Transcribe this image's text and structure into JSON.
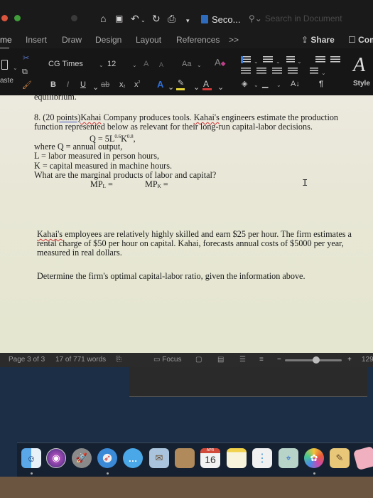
{
  "window": {
    "doc_title": "Seco...",
    "search_placeholder": "Search in Document"
  },
  "quick_access": {
    "home_icon": "⌂",
    "save_icon": "💾",
    "undo_icon": "↶",
    "redo_icon": "↻",
    "print_icon": "⎙",
    "more_icon": "▾"
  },
  "tabs": [
    {
      "label": "me",
      "active": true
    },
    {
      "label": "Insert"
    },
    {
      "label": "Draw"
    },
    {
      "label": "Design"
    },
    {
      "label": "Layout"
    },
    {
      "label": "References"
    },
    {
      "label": ">>"
    }
  ],
  "share_label": "Share",
  "comments_label": "Com",
  "ribbon": {
    "font_name": "CG Times",
    "font_size": "12",
    "grow_font": "A",
    "shrink_font": "A",
    "change_case": "Aa",
    "paste_label": "aste",
    "bold": "B",
    "italic": "I",
    "underline": "U",
    "strikethrough": "ab",
    "subscript": "x",
    "superscript": "x",
    "text_effects": "A",
    "highlight": "✎",
    "font_color": "A",
    "sort": "A↓",
    "pilcrow": "¶",
    "styles_label": "Style",
    "highlight_color": "#e8d63a",
    "font_color_value": "#d23a3a",
    "text_effects_color": "#2f6fd8"
  },
  "document": {
    "cut_off_line": "equilibrium.",
    "q8_num": "8. (20 ",
    "q8_points": "points)",
    "q8_kahai": "Kahai",
    "q8_rest1": " Company produces tools.  ",
    "q8_kahais": "Kahai's",
    "q8_rest2": " engineers estimate the production",
    "line2": "function represented below as relevant for their long-run capital-labor decisions.",
    "formula_pre": "Q = 5L",
    "formula_exp1": "0.6",
    "formula_k": "K",
    "formula_exp2": "0.8",
    "formula_post": ",",
    "where_q": "where Q = annual output,",
    "where_l": "L = labor measured in person hours,",
    "where_k": "K = capital measured in machine hours.",
    "question_mp": "What are the marginal products of labor and capital?",
    "mpl_label": "MP",
    "mpl_sub": "L",
    "mpl_eq": " =",
    "mpk_label": "MP",
    "mpk_sub": "K",
    "mpk_eq": " =",
    "p2_kahais": "Kahai's",
    "p2_line1": " employees are relatively highly skilled and earn $25 per hour. The firm estimates a",
    "p2_line2": "rental charge of $50 per hour on capital.  Kahai, forecasts annual costs of $5000 per year,",
    "p2_line3": "measured in real dollars.",
    "determine": "Determine the firm's optimal capital-labor ratio, given the information above.",
    "cursor": "I"
  },
  "status_bar": {
    "page": "Page 3 of 3",
    "words": "17 of 771 words",
    "focus": "Focus",
    "zoom_minus": "−",
    "zoom_plus": "+",
    "zoom_level": "129",
    "zoom_fraction": 0.55
  },
  "dock": {
    "items": [
      {
        "name": "finder",
        "glyph": "☺",
        "color": "#5aa8e8"
      },
      {
        "name": "siri",
        "glyph": "◉",
        "color": "#6a3a9a"
      },
      {
        "name": "launchpad",
        "glyph": "🚀",
        "color": "#7a7a7a"
      },
      {
        "name": "safari",
        "glyph": "⊘",
        "color": "#3a8ad8"
      },
      {
        "name": "messages",
        "glyph": "…",
        "color": "#4aa8e8"
      },
      {
        "name": "mail",
        "glyph": "✉",
        "color": "#a9c4dc"
      },
      {
        "name": "notes-book",
        "glyph": "",
        "color": "#b08a5a"
      },
      {
        "name": "calendar",
        "month": "APR",
        "day": "16"
      },
      {
        "name": "notes",
        "glyph": "",
        "color": "#f2e6a8"
      },
      {
        "name": "reminders",
        "glyph": "⋮",
        "color": "#f0f0f0"
      },
      {
        "name": "maps",
        "glyph": "⌖",
        "color": "#b8d4c8"
      },
      {
        "name": "photos",
        "glyph": "✿",
        "color": "#f5f5f5"
      },
      {
        "name": "preview",
        "glyph": "✎",
        "color": "#e8c878"
      }
    ]
  }
}
